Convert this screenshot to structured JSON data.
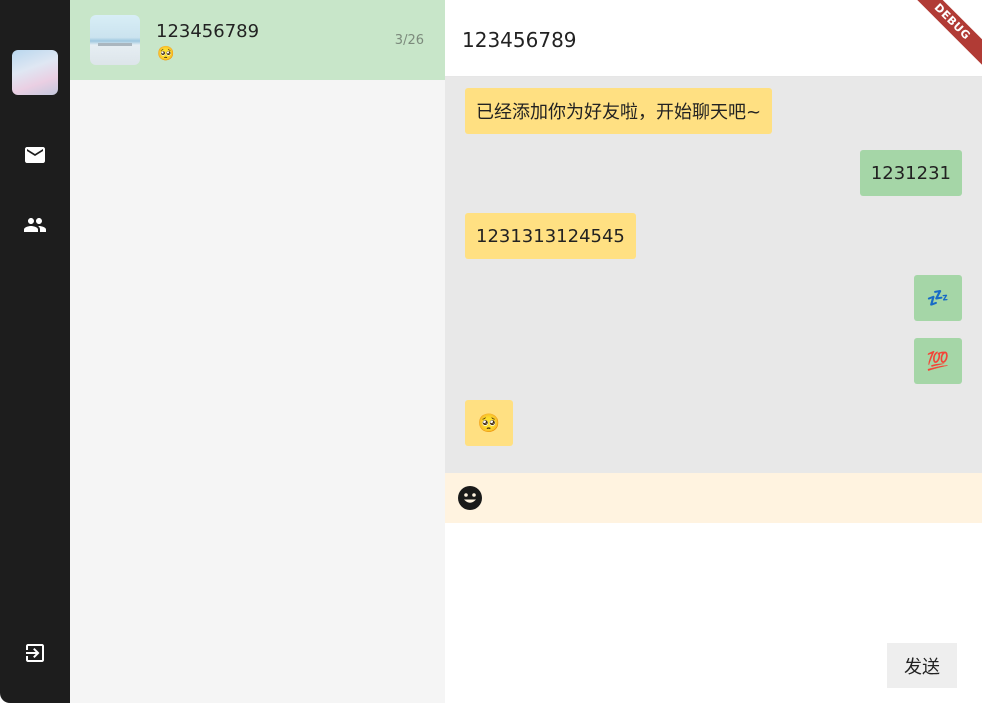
{
  "conversation_list": {
    "items": [
      {
        "name": "123456789",
        "preview": "🥺",
        "date": "3/26"
      }
    ]
  },
  "chat": {
    "title": "123456789",
    "debug_label": "DEBUG",
    "messages": [
      {
        "side": "left",
        "text": "已经添加你为好友啦，开始聊天吧~"
      },
      {
        "side": "right",
        "text": "1231231"
      },
      {
        "side": "left",
        "text": "1231313124545"
      },
      {
        "side": "right",
        "text": "💤"
      },
      {
        "side": "right",
        "text": "💯"
      },
      {
        "side": "left",
        "text": "🥺"
      }
    ],
    "composer_value": "",
    "send_label": "发送"
  },
  "icons": {
    "rail": [
      "avatar",
      "mail-icon",
      "people-icon",
      "logout-icon"
    ],
    "toolbar": [
      "emoji-icon"
    ]
  },
  "colors": {
    "rail_bg": "#1d1d1d",
    "list_bg": "#f5f5f5",
    "selected_item_bg": "#c8e6c9",
    "message_area_bg": "#e8e8e8",
    "incoming_bubble": "#ffe082",
    "outgoing_bubble": "#a5d6a7",
    "toolbar_bg": "#fff3e0",
    "send_button_bg": "#eeeeee",
    "debug_banner": "#b13b35"
  }
}
